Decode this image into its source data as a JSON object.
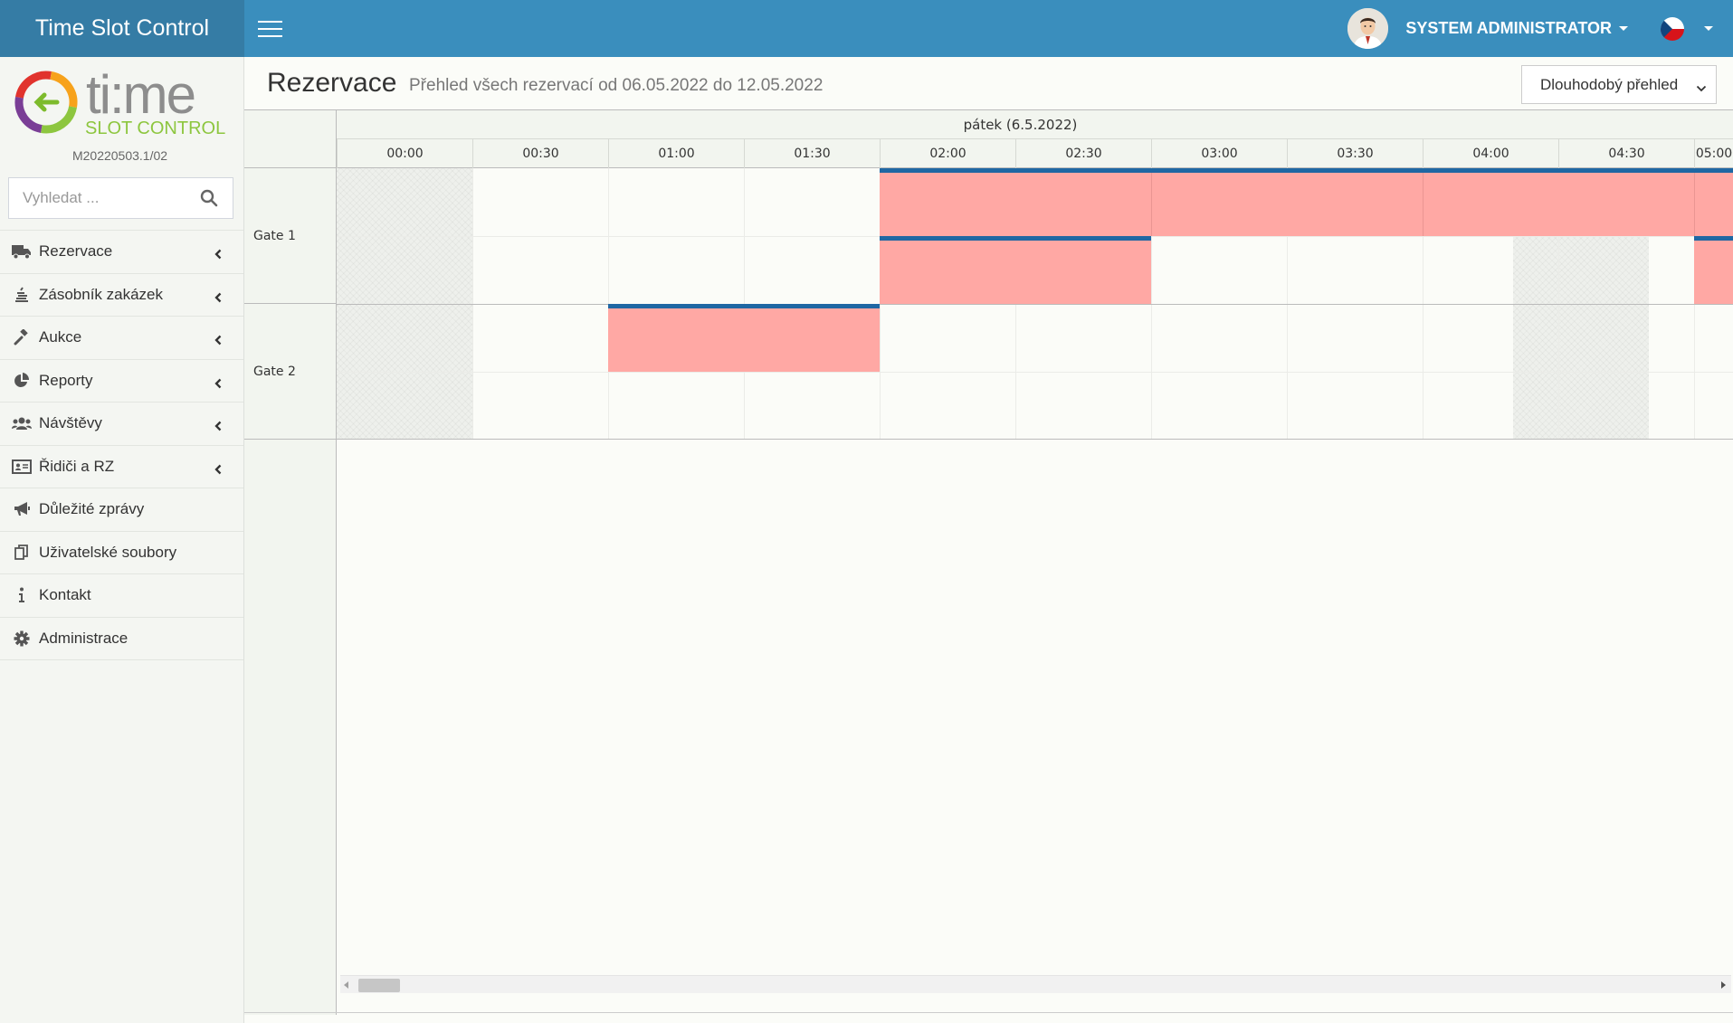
{
  "app": {
    "title": "Time Slot Control"
  },
  "user": {
    "name": "SYSTEM ADMINISTRATOR"
  },
  "logo": {
    "wordmark": "ti:me",
    "tagline": "SLOT CONTROL",
    "version": "M20220503.1/02"
  },
  "search": {
    "placeholder": "Vyhledat ..."
  },
  "menu": [
    {
      "label": "Rezervace",
      "icon": "truck-icon",
      "submenu": true
    },
    {
      "label": "Zásobník zakázek",
      "icon": "stack-icon",
      "submenu": true
    },
    {
      "label": "Aukce",
      "icon": "gavel-icon",
      "submenu": true
    },
    {
      "label": "Reporty",
      "icon": "pie-chart-icon",
      "submenu": true
    },
    {
      "label": "Návštěvy",
      "icon": "users-icon",
      "submenu": true
    },
    {
      "label": "Řidiči a RZ",
      "icon": "id-card-icon",
      "submenu": true
    },
    {
      "label": "Důležité zprávy",
      "icon": "bullhorn-icon",
      "submenu": false
    },
    {
      "label": "Uživatelské soubory",
      "icon": "files-icon",
      "submenu": false
    },
    {
      "label": "Kontakt",
      "icon": "info-icon",
      "submenu": false
    },
    {
      "label": "Administrace",
      "icon": "gear-icon",
      "submenu": false
    }
  ],
  "page": {
    "title": "Rezervace",
    "subtitle": "Přehled všech rezervací od 06.05.2022 do 12.05.2022",
    "view_select": "Dlouhodobý přehled"
  },
  "schedule": {
    "day": "pátek (6.5.2022)",
    "times": [
      "00:00",
      "00:30",
      "01:00",
      "01:30",
      "02:00",
      "02:30",
      "03:00",
      "03:30",
      "04:00",
      "04:30",
      "05:00"
    ],
    "gates": [
      "Gate 1",
      "Gate 2"
    ]
  },
  "colors": {
    "topbar": "#3a8ebd",
    "brand": "#357ca5",
    "event": "#ffa8a4",
    "event_border": "#1f67a3"
  }
}
